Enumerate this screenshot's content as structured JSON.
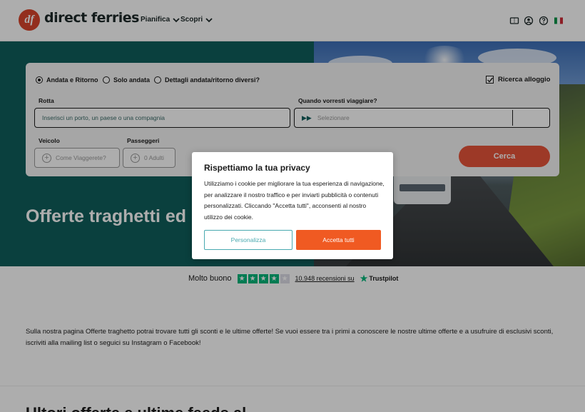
{
  "header": {
    "logo_mark": "df",
    "logo_text": "direct ferries",
    "nav": [
      {
        "label": "Pianifica"
      },
      {
        "label": "Scopri"
      }
    ],
    "icons": [
      "ticket-icon",
      "account-icon",
      "help-icon",
      "italian-flag-icon"
    ]
  },
  "search": {
    "trip_types": [
      {
        "label": "Andata e Ritorno",
        "selected": true
      },
      {
        "label": "Solo andata",
        "selected": false
      },
      {
        "label": "Dettagli andata/ritorno diversi?",
        "selected": false
      }
    ],
    "accommodation_label": "Ricerca alloggio",
    "accommodation_checked": true,
    "route_label": "Rotta",
    "route_placeholder": "Inserisci un porto, un paese o una compagnia",
    "date_label": "Quando vorresti viaggiare?",
    "date_placeholder": "Selezionare",
    "vehicle_label": "Veicolo",
    "vehicle_placeholder": "Come Viaggerete?",
    "passengers_label": "Passeggeri",
    "passengers_placeholder": "0 Adulti",
    "search_button": "Cerca"
  },
  "hero": {
    "title": "Offerte traghetti ed novità"
  },
  "trustpilot": {
    "rating_text": "Molto buono",
    "stars_filled": 4,
    "stars_total": 5,
    "reviews_link": "10.948 recensioni su",
    "brand": "Trustpilot"
  },
  "body_text": "Sulla nostra pagina Offerte traghetto potrai trovare tutti gli sconti e le ultime offerte! Se vuoi essere tra i primi a conoscere le nostre ultime offerte e a usufruire di esclusivi sconti, iscriviti alla mailing list o seguici su Instagram o Facebook!",
  "section_title": "Ultori offerte e ultime feeds al",
  "cookie_modal": {
    "title": "Rispettiamo la tua privacy",
    "body": "Utilizziamo i cookie per migliorare la tua esperienza di navigazione, per analizzare il nostro traffico e per inviarti pubblicità o contenuti personalizzati. Cliccando \"Accetta tutti\", acconsenti al nostro utilizzo dei cookie.",
    "customize_button": "Personalizza",
    "accept_button": "Accetta tutti"
  },
  "colors": {
    "brand_orange": "#e8553a",
    "teal": "#0f5f5c",
    "accept_orange": "#f05a22",
    "customize_teal": "#49a9b0",
    "trustpilot_green": "#00b67a"
  }
}
